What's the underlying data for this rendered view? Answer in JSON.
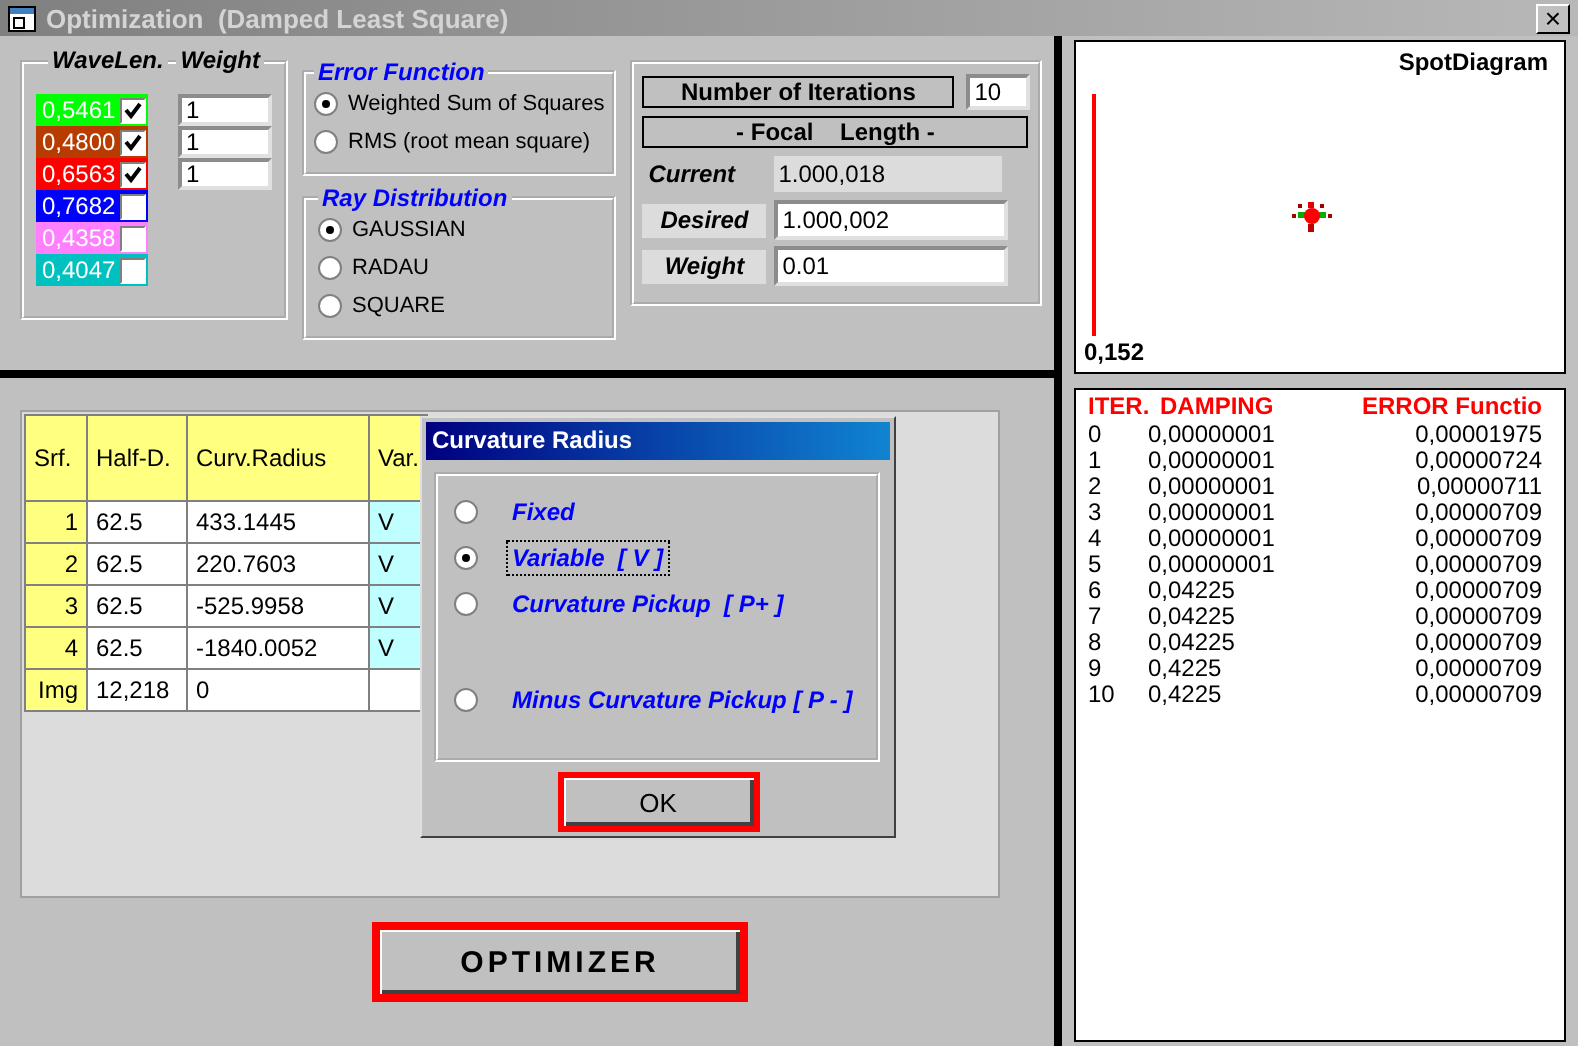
{
  "window": {
    "title": "Optimization  (Damped Least Square)",
    "close": "×"
  },
  "wavelengths": {
    "title": "WaveLen.",
    "weight_title": "Weight",
    "items": [
      {
        "value": "0,5461",
        "color": "#00ff00",
        "checked": true,
        "weight": "1"
      },
      {
        "value": "0,4800",
        "color": "#b83c00",
        "checked": true,
        "weight": "1"
      },
      {
        "value": "0,6563",
        "color": "#ff0000",
        "checked": true,
        "weight": "1"
      },
      {
        "value": "0,7682",
        "color": "#0000ff",
        "checked": false
      },
      {
        "value": "0,4358",
        "color": "#ff80ff",
        "checked": false
      },
      {
        "value": "0,4047",
        "color": "#00c0c0",
        "checked": false
      }
    ]
  },
  "error_function": {
    "title": "Error Function",
    "options": [
      {
        "label": "Weighted Sum of Squares",
        "selected": true
      },
      {
        "label": "RMS (root mean square)",
        "selected": false
      }
    ]
  },
  "ray_distribution": {
    "title": "Ray Distribution",
    "options": [
      {
        "label": "GAUSSIAN",
        "selected": true
      },
      {
        "label": "RADAU",
        "selected": false
      },
      {
        "label": "SQUARE",
        "selected": false
      }
    ]
  },
  "iterations": {
    "label": "Number of Iterations",
    "value": "10"
  },
  "focal": {
    "heading": "- Focal    Length -",
    "current_label": "Current",
    "current": "1.000,018",
    "desired_label": "Desired",
    "desired": "1.000,002",
    "weight_label": "Weight",
    "weight": "0.01"
  },
  "spot_diagram": {
    "title": "SpotDiagram",
    "scale": "0,152"
  },
  "log": {
    "columns": [
      "ITER.",
      "DAMPING",
      "ERROR Functio"
    ],
    "rows": [
      [
        "0",
        "0,00000001",
        "0,00001975"
      ],
      [
        "1",
        "0,00000001",
        "0,00000724"
      ],
      [
        "2",
        "0,00000001",
        "0,00000711"
      ],
      [
        "3",
        "0,00000001",
        "0,00000709"
      ],
      [
        "4",
        "0,00000001",
        "0,00000709"
      ],
      [
        "5",
        "0,00000001",
        "0,00000709"
      ],
      [
        "6",
        "0,04225",
        "0,00000709"
      ],
      [
        "7",
        "0,04225",
        "0,00000709"
      ],
      [
        "8",
        "0,04225",
        "0,00000709"
      ],
      [
        "9",
        "0,4225",
        "0,00000709"
      ],
      [
        "10",
        "0,4225",
        "0,00000709"
      ]
    ]
  },
  "surfaces": {
    "columns": [
      "Srf.",
      "Half-D.",
      "Curv.Radius",
      "Var."
    ],
    "rows": [
      {
        "srf": "1",
        "half_d": "62.5",
        "radius": "433.1445",
        "var": "V"
      },
      {
        "srf": "2",
        "half_d": "62.5",
        "radius": "220.7603",
        "var": "V"
      },
      {
        "srf": "3",
        "half_d": "62.5",
        "radius": "-525.9958",
        "var": "V"
      },
      {
        "srf": "4",
        "half_d": "62.5",
        "radius": "-1840.0052",
        "var": "V"
      },
      {
        "srf": "Img",
        "half_d": "12,218",
        "radius": "0"
      }
    ]
  },
  "dialog": {
    "title": "Curvature Radius",
    "options": [
      {
        "label": "Fixed",
        "selected": false
      },
      {
        "label": "Variable  [ V ]",
        "selected": true
      },
      {
        "label": "Curvature Pickup  [ P+ ]",
        "selected": false
      },
      {
        "label": "Minus Curvature Pickup [ P - ]",
        "selected": false
      }
    ],
    "ok": "OK"
  },
  "optimizer": "OPTIMIZER"
}
